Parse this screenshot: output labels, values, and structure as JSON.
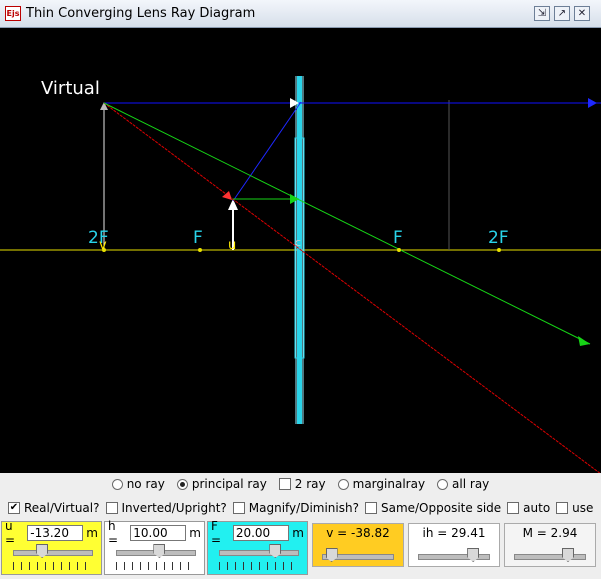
{
  "window": {
    "icon_text": "Ejs",
    "title": "Thin Converging Lens Ray Diagram"
  },
  "diagram": {
    "image_type_label": "Virtual",
    "axis_labels": [
      "2F",
      "F",
      "F",
      "2F"
    ],
    "image_marker": "v",
    "object_marker": "u",
    "center_marker": "c",
    "colors": {
      "axis": "#e8e000",
      "lens": "#29d4ea",
      "ray_parallel": "#1010ff",
      "ray_center": "#dd0000",
      "ray_focus": "#16d416",
      "image": "#ffffff"
    }
  },
  "ray_options": [
    {
      "label": "no ray",
      "selected": false
    },
    {
      "label": "principal ray",
      "selected": true
    },
    {
      "label": "2 ray",
      "selected": false,
      "type": "check"
    },
    {
      "label": "marginalray",
      "selected": false
    },
    {
      "label": "all ray",
      "selected": false
    }
  ],
  "checks": [
    {
      "label": "Real/Virtual?",
      "checked": true
    },
    {
      "label": "Inverted/Upright?",
      "checked": false
    },
    {
      "label": "Magnify/Diminish?",
      "checked": false
    },
    {
      "label": "Same/Opposite side",
      "checked": false
    },
    {
      "label": "auto",
      "checked": false
    },
    {
      "label": "use",
      "checked": false
    }
  ],
  "inputs": {
    "u": {
      "label": "u =",
      "value": "-13.20",
      "unit": "m",
      "slider_fraction": 0.34,
      "color": "#ffff33"
    },
    "h": {
      "label": "h =",
      "value": "10.00",
      "unit": "m",
      "slider_fraction": 0.55,
      "color": "#ffffff"
    },
    "F": {
      "label": "F =",
      "value": "20.00",
      "unit": "m",
      "slider_fraction": 0.74,
      "color": "#22f0f0"
    }
  },
  "outputs": {
    "v": {
      "text": "v = -38.82",
      "slider_fraction": 0.06,
      "color": "#ffcc22"
    },
    "ih": {
      "text": "ih = 29.41",
      "slider_fraction": 0.82,
      "color": "#ffffff"
    },
    "M": {
      "text": "M = 2.94",
      "slider_fraction": 0.8,
      "color": "#f4f4f4"
    }
  }
}
